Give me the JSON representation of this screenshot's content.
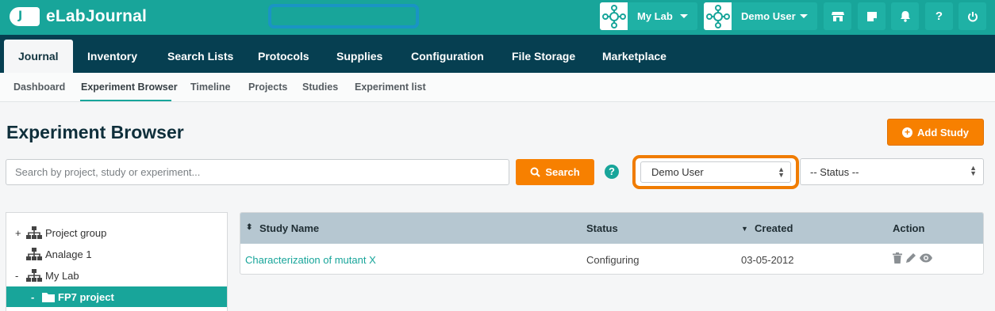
{
  "app": {
    "logo_badge": "J",
    "title": "eLabJournal"
  },
  "header": {
    "lab_selector": "My Lab",
    "user_selector": "Demo User",
    "icons": [
      "store-icon",
      "notes-icon",
      "bell-icon",
      "help-icon",
      "power-icon"
    ],
    "help_glyph": "?"
  },
  "main_nav": {
    "tabs": [
      {
        "label": "Journal"
      },
      {
        "label": "Inventory"
      },
      {
        "label": "Search Lists"
      },
      {
        "label": "Protocols"
      },
      {
        "label": "Supplies"
      },
      {
        "label": "Configuration"
      },
      {
        "label": "File Storage"
      },
      {
        "label": "Marketplace"
      }
    ],
    "active": "Journal"
  },
  "sub_nav": {
    "items": [
      {
        "label": "Dashboard"
      },
      {
        "label": "Experiment Browser"
      },
      {
        "label": "Timeline"
      },
      {
        "label": "Projects"
      },
      {
        "label": "Studies"
      },
      {
        "label": "Experiment list"
      }
    ],
    "active": "Experiment Browser"
  },
  "page": {
    "title": "Experiment Browser",
    "add_study_label": "Add Study",
    "search_placeholder": "Search by project, study or experiment...",
    "search_button": "Search",
    "help_glyph": "?",
    "user_filter": "Demo User",
    "status_filter": "-- Status --"
  },
  "tree": {
    "items": [
      {
        "toggle": "+",
        "label": "Project group",
        "icon": "hierarchy-icon"
      },
      {
        "toggle": "",
        "label": "Analage 1",
        "icon": "hierarchy-icon"
      },
      {
        "toggle": "-",
        "label": "My Lab",
        "icon": "hierarchy-icon"
      },
      {
        "toggle": "-",
        "label": "FP7 project",
        "icon": "folder-icon",
        "selected": true
      }
    ]
  },
  "study_table": {
    "columns": [
      "Study Name",
      "Status",
      "Created",
      "Action"
    ],
    "rows": [
      {
        "name": "Characterization of mutant X",
        "status": "Configuring",
        "created": "03-05-2012"
      }
    ]
  },
  "colors": {
    "teal": "#18a59a",
    "dark_nav": "#063f51",
    "orange": "#f78000",
    "table_header": "#b6c7d1"
  }
}
